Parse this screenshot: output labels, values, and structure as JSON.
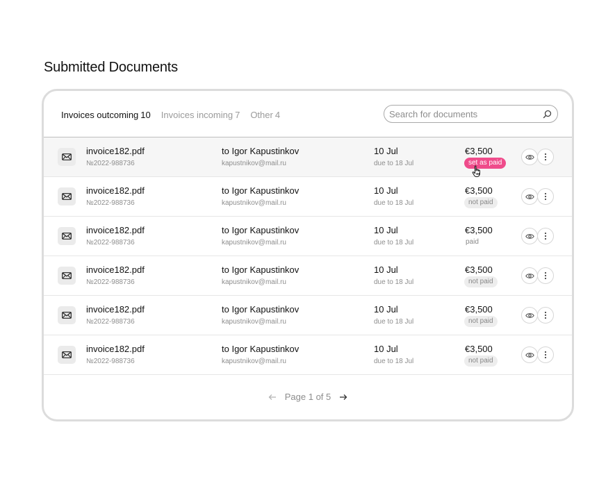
{
  "page": {
    "title": "Submitted Documents"
  },
  "tabs": [
    {
      "label": "Invoices outcoming",
      "count": "10"
    },
    {
      "label": "Invoices incoming",
      "count": "7"
    },
    {
      "label": "Other",
      "count": "4"
    }
  ],
  "search": {
    "placeholder": "Search for documents"
  },
  "rows": [
    {
      "file": "invoice182.pdf",
      "number": "№2022-988736",
      "recipient": "to Igor Kapustinkov",
      "email": "kapustnikov@mail.ru",
      "date": "10 Jul",
      "due": "due to 18 Jul",
      "amount": "€3,500",
      "status": "set as paid"
    },
    {
      "file": "invoice182.pdf",
      "number": "№2022-988736",
      "recipient": "to Igor Kapustinkov",
      "email": "kapustnikov@mail.ru",
      "date": "10 Jul",
      "due": "due to 18 Jul",
      "amount": "€3,500",
      "status": "not paid"
    },
    {
      "file": "invoice182.pdf",
      "number": "№2022-988736",
      "recipient": "to Igor Kapustinkov",
      "email": "kapustnikov@mail.ru",
      "date": "10 Jul",
      "due": "due to 18 Jul",
      "amount": "€3,500",
      "status": "paid"
    },
    {
      "file": "invoice182.pdf",
      "number": "№2022-988736",
      "recipient": "to Igor Kapustinkov",
      "email": "kapustnikov@mail.ru",
      "date": "10 Jul",
      "due": "due to 18 Jul",
      "amount": "€3,500",
      "status": "not paid"
    },
    {
      "file": "invoice182.pdf",
      "number": "№2022-988736",
      "recipient": "to Igor Kapustinkov",
      "email": "kapustnikov@mail.ru",
      "date": "10 Jul",
      "due": "due to 18 Jul",
      "amount": "€3,500",
      "status": "not paid"
    },
    {
      "file": "invoice182.pdf",
      "number": "№2022-988736",
      "recipient": "to Igor Kapustinkov",
      "email": "kapustnikov@mail.ru",
      "date": "10 Jul",
      "due": "due to 18 Jul",
      "amount": "€3,500",
      "status": "not paid"
    }
  ],
  "pagination": {
    "label": "Page 1 of 5"
  },
  "icons": {
    "file": "envelope-icon",
    "search": "search-icon",
    "view": "eye-icon",
    "more": "more-vertical-icon",
    "prev": "arrow-left-icon",
    "next": "arrow-right-icon",
    "cursor": "hand-pointer-icon"
  },
  "colors": {
    "accent": "#ef4c8b",
    "border": "#dcdcdc",
    "muted": "#8d8d8d"
  }
}
